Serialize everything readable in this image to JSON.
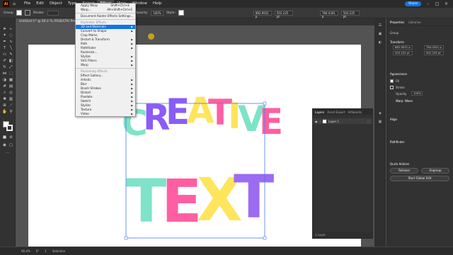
{
  "menubar": {
    "app_icon": "Ai",
    "home_icon": "home-icon",
    "items": [
      "File",
      "Edit",
      "Object",
      "Type",
      "Select",
      "Effect",
      "View",
      "Window",
      "Help"
    ],
    "active_index": 5,
    "share_label": "Share"
  },
  "controlbar": {
    "label": "Group",
    "stroke_label": "Stroke:",
    "opacity_label": "Opacity:",
    "opacity_value": "100%",
    "style_label": "Style:",
    "x_value": "882.9031 p",
    "y_value": "502.225 pt",
    "w_value": "784.4341 p",
    "h_value": "502.225 pt"
  },
  "doc_tab": {
    "title": "Untitled-1* @ 66.4 % (RGB/CPU Preview)",
    "close": "×"
  },
  "effect_menu": {
    "apply_warp": "Apply Warp",
    "apply_warp_shortcut": "Shift+Ctrl+E",
    "warp": "Warp...",
    "warp_shortcut": "Alt+Shift+Ctrl+E",
    "doc_raster": "Document Raster Effects Settings...",
    "illustrator_header": "Illustrator Effects",
    "illustrator_items": [
      "3D and Materials",
      "Convert to Shape",
      "Crop Marks",
      "Distort & Transform",
      "Path",
      "Pathfinder",
      "Rasterize...",
      "Stylize",
      "SVG Filters",
      "Warp"
    ],
    "photoshop_header": "Photoshop Effects",
    "photoshop_items": [
      "Effect Gallery...",
      "Artistic",
      "Blur",
      "Brush Strokes",
      "Distort",
      "Pixelate",
      "Sketch",
      "Stylize",
      "Texture",
      "Video"
    ]
  },
  "artwork": {
    "line1": "CREATIVE",
    "line2": "TEXT",
    "colors": {
      "purple": "#8b5cf6",
      "mint": "#7ee3c8",
      "pink": "#ff5fa2",
      "yellow": "#ffe55c",
      "violet": "#9b6bf2"
    }
  },
  "layers_panel": {
    "tabs": [
      "Layers",
      "Asset Export",
      "Artboards"
    ],
    "layer_name": "Layer 1",
    "footer": "1 Layer"
  },
  "properties": {
    "tabs": [
      "Properties",
      "Libraries"
    ],
    "group_label": "Group",
    "transform_label": "Transform",
    "x": "882.9031 p",
    "y": "502.225 pt",
    "w": "784.4341 p",
    "h": "502.225 pt",
    "appearance_label": "Appearance",
    "fill_label": "Fill",
    "stroke_label": "Stroke",
    "opacity_label": "Opacity",
    "opacity_value": "100%",
    "warp_label": "Warp: Wave",
    "align_label": "Align",
    "pathfinder_label": "Pathfinder",
    "quick_actions_label": "Quick Actions",
    "release_label": "Release",
    "ungroup_label": "Ungroup",
    "global_edit_label": "Start Global Edit"
  },
  "statusbar": {
    "zoom": "66.4%",
    "rotation": "0°",
    "artboard": "1",
    "mode": "Selection"
  }
}
